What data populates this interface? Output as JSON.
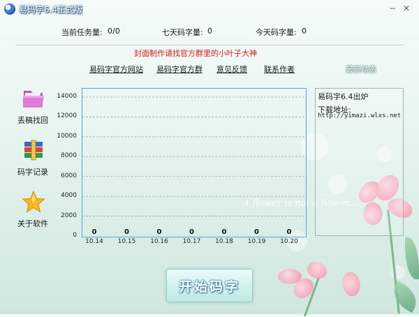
{
  "window": {
    "title": "易码字6.4正式版",
    "controls": {
      "minimize": "−",
      "close": "✕"
    }
  },
  "stats": {
    "current_task_label": "当前任务量:",
    "current_task_value": "0/0",
    "seven_day_label": "七天码字量:",
    "seven_day_value": "0",
    "today_label": "今天码字量:",
    "today_value": "0"
  },
  "notice": "封面制作请找官方群里的小叶子大神",
  "links": [
    "易码字官方网站",
    "易码字官方群",
    "意见反馈",
    "联系作者"
  ],
  "latest": {
    "title": "最新动态",
    "line1": "易码字6.4出炉",
    "line2": "下载地址:",
    "url": "http://yimazi.wlxs.net"
  },
  "sidebar": [
    {
      "label": "丢稿找回",
      "icon": "folder-icon"
    },
    {
      "label": "码字记录",
      "icon": "books-icon"
    },
    {
      "label": "关于软件",
      "icon": "star-icon"
    }
  ],
  "chart_data": {
    "type": "bar",
    "categories": [
      "10.14",
      "10.15",
      "10.16",
      "10.17",
      "10.18",
      "10.19",
      "10.20"
    ],
    "values": [
      0,
      0,
      0,
      0,
      0,
      0,
      0
    ],
    "yticks": [
      "14000",
      "12000",
      "10000",
      "8000",
      "6000",
      "4000",
      "2000",
      "0"
    ],
    "ylim": [
      0,
      14000
    ],
    "grid": true
  },
  "decor_text": "A flower is not a flower...",
  "start_button": "开始码字",
  "colors": {
    "notice": "#e02020",
    "chart_border": "#5aa0e8"
  }
}
